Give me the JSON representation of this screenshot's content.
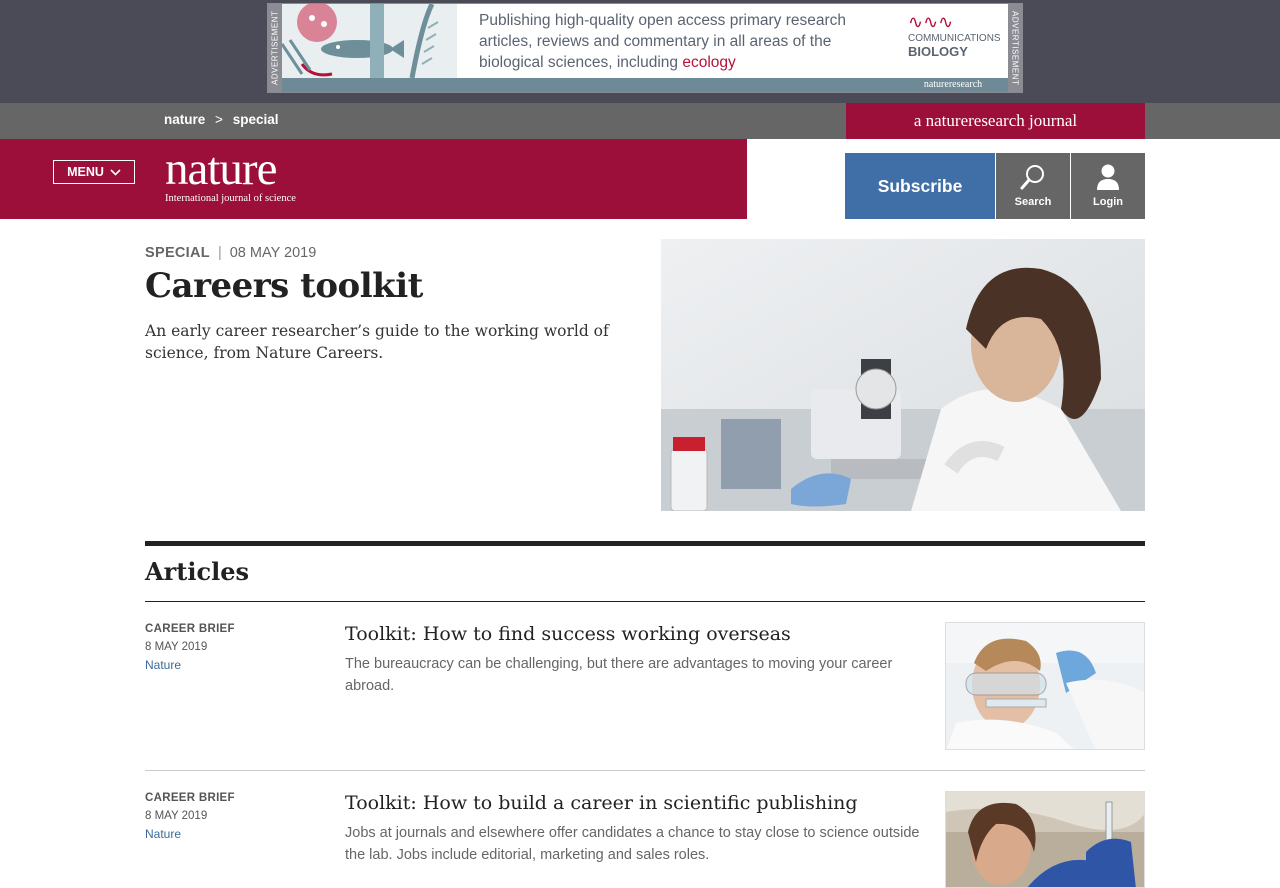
{
  "ad": {
    "side_label": "ADVERTISEMENT",
    "text_main": "Publishing high-quality open access primary research articles, reviews and commentary in all areas of the biological sciences, including",
    "text_highlight": "ecology",
    "logo_line1": "COMMUNICATIONS",
    "logo_line2": "BIOLOGY",
    "footer_brand": "natureresearch"
  },
  "breadcrumb": {
    "home": "nature",
    "separator": ">",
    "current": "special"
  },
  "nr_journal_label": "a natureresearch journal",
  "header": {
    "menu_label": "MENU",
    "logo_word": "nature",
    "logo_tagline": "International journal of science",
    "subscribe_label": "Subscribe",
    "search_label": "Search",
    "login_label": "Login"
  },
  "hero": {
    "kind": "SPECIAL",
    "date": "08 MAY 2019",
    "title": "Careers toolkit",
    "subtitle": "An early career researcher’s guide to the working world of science, from Nature Careers."
  },
  "articles": {
    "heading": "Articles",
    "items": [
      {
        "type": "CAREER BRIEF",
        "date": "8 MAY 2019",
        "journal": "Nature",
        "title": "Toolkit: How to find success working overseas",
        "description": "The bureaucracy can be challenging, but there are advantages to moving your career abroad."
      },
      {
        "type": "CAREER BRIEF",
        "date": "8 MAY 2019",
        "journal": "Nature",
        "title": "Toolkit: How to build a career in scientific publishing",
        "description": "Jobs at journals and elsewhere offer candidates a chance to stay close to science outside the lab. Jobs include editorial, marketing and sales roles."
      }
    ]
  },
  "colors": {
    "brand": "#9b0f3a",
    "subscribe": "#3f6fa6",
    "link": "#3b6a9a",
    "bar_grey": "#666666"
  }
}
